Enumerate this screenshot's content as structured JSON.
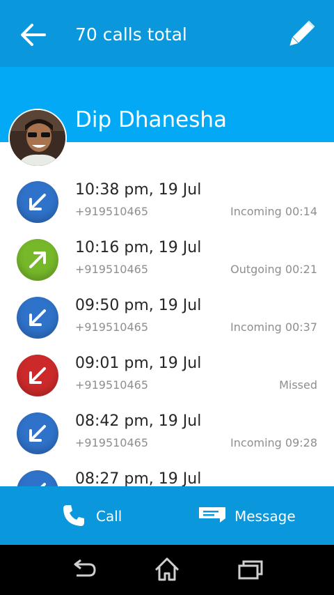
{
  "header": {
    "title": "70 calls total",
    "back_icon": "arrow-left-icon",
    "edit_icon": "pencil-icon"
  },
  "contact": {
    "name": "Dip Dhanesha"
  },
  "calls": [
    {
      "time": "10:38 pm, 19 Jul",
      "number": "+919510465",
      "status": "Incoming 00:14",
      "type": "incoming"
    },
    {
      "time": "10:16 pm, 19 Jul",
      "number": "+919510465",
      "status": "Outgoing 00:21",
      "type": "outgoing"
    },
    {
      "time": "09:50 pm, 19 Jul",
      "number": "+919510465",
      "status": "Incoming 00:37",
      "type": "incoming"
    },
    {
      "time": "09:01 pm, 19 Jul",
      "number": "+919510465",
      "status": "Missed",
      "type": "missed"
    },
    {
      "time": "08:42 pm, 19 Jul",
      "number": "+919510465",
      "status": "Incoming 09:28",
      "type": "incoming"
    },
    {
      "time": "08:27 pm, 19 Jul",
      "number": "",
      "status": "",
      "type": "incoming"
    }
  ],
  "actions": {
    "call_label": "Call",
    "message_label": "Message"
  },
  "colors": {
    "appbar": "#0a97dc",
    "contact_band": "#03a9f4",
    "incoming": "#2f72c9",
    "outgoing": "#76b82a",
    "missed": "#cc2a2a"
  }
}
